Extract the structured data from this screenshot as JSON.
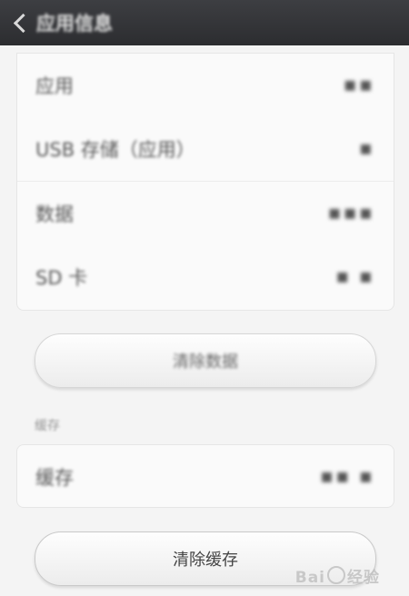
{
  "header": {
    "title": "应用信息"
  },
  "storage": {
    "rows": [
      {
        "label": "应用",
        "value": "■■"
      },
      {
        "label": "USB 存储（应用）",
        "value": "■"
      },
      {
        "label": "数据",
        "value": "■■■"
      },
      {
        "label": "SD 卡",
        "value": "■ ■"
      }
    ]
  },
  "buttons": {
    "clear_data": "清除数据",
    "clear_cache": "清除缓存"
  },
  "cache": {
    "section_title": "缓存",
    "row": {
      "label": "缓存",
      "value": "■■ ■"
    }
  },
  "watermark": {
    "text": "Bai",
    "text2": "经验"
  }
}
